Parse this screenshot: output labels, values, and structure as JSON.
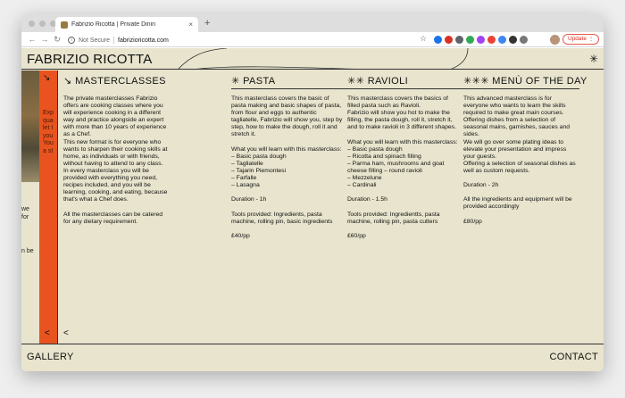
{
  "browser": {
    "tab_title": "Fabrizio Ricotta | Private Dinin",
    "tab_close": "×",
    "new_tab": "+",
    "security_label": "Not Secure",
    "url": "fabrizioricotta.com",
    "update_label": "Update",
    "nav": {
      "back": "←",
      "forward": "→",
      "reload": "↻"
    },
    "star": "☆"
  },
  "site": {
    "logo": "FABRIZIO RICOTTA",
    "top_symbol": "✳",
    "orange_panel": {
      "arrow": "↘",
      "text": [
        "Exp",
        "qua",
        "let I",
        "you",
        "You",
        "a st"
      ],
      "back": "<"
    },
    "left_strip_text": {
      "group1": [
        "we",
        "for"
      ],
      "group2": [
        "n be"
      ]
    },
    "columns": [
      {
        "heading": "↘ MASTERCLASSES",
        "body": "The private masterclasses Fabrizio offers are cooking classes where you will experience cooking in a different way and practice alongside an expert with more than 10 years of experience as a Chef.\nThis new format is for everyone who wants to sharpen their cooking skills at home, as individuals or with friends, without having to attend to any class.\nIn every masterclass you will be provided with everything you need, recipes included, and you will be learning, cooking, and eating, because that's what a Chef does.\n\nAll the masterclasses can be catered for any dietary requirement."
      },
      {
        "heading": "✳ PASTA",
        "body": "This masterclass covers the basic of pasta making and basic shapes of pasta, from flour and eggs to authentic tagliatelle, Fabrizio will show you, step by step, how to make the dough, roll it and stretch it.\n\nWhat you will learn with this masterclass:\n– Basic pasta dough\n– Tagliatelle\n– Tajarin Piemontesi\n– Farfalle\n– Lasagna\n\nDuration - 1h\n\nTools provided: Ingredients, pasta machine, rolling pin, basic ingredients\n\n£40/pp"
      },
      {
        "heading": "✳✳ RAVIOLI",
        "body": "This masterclass covers the basics of filled pasta such as Ravioli.\nFabrizio will show you hot to make the filling, the pasta dough, roll it, stretch it, and to make ravioli in 3 different shapes.\n\nWhat you will learn with this masterclass:\n– Basic pasta dough\n– Ricotta and spinach filling\n– Parma ham, mushrooms and goat cheese filling – round ravioli\n– Mezzelune\n– Cardinali\n\nDuration - 1.5h\n\nTools provided: Ingredientts, pasta machine, rolling pin, pasta cutters\n\n£60/pp"
      },
      {
        "heading": "✳✳✳ MENÙ OF THE DAY",
        "body": "This advanced masterclass is for everyone who wants to learn the skills required to make great main courses.\nOffering dishes from a selection of seasonal mains, garnishes, sauces and sides.\nWe will go over some plating ideas to elevate your presentation and impress your guests.\nOffering a selection of seasonal dishes as well as custom requests.\n\nDuration - 2h\n\nAll the ingredients and equipment will be provided accordingly\n\n£80/pp"
      }
    ],
    "back_arrow": "<",
    "footer": {
      "left": "GALLERY",
      "right": "CONTACT"
    }
  },
  "colors": {
    "background": "#e8e4cd",
    "accent": "#e8531f",
    "text": "#111111"
  }
}
